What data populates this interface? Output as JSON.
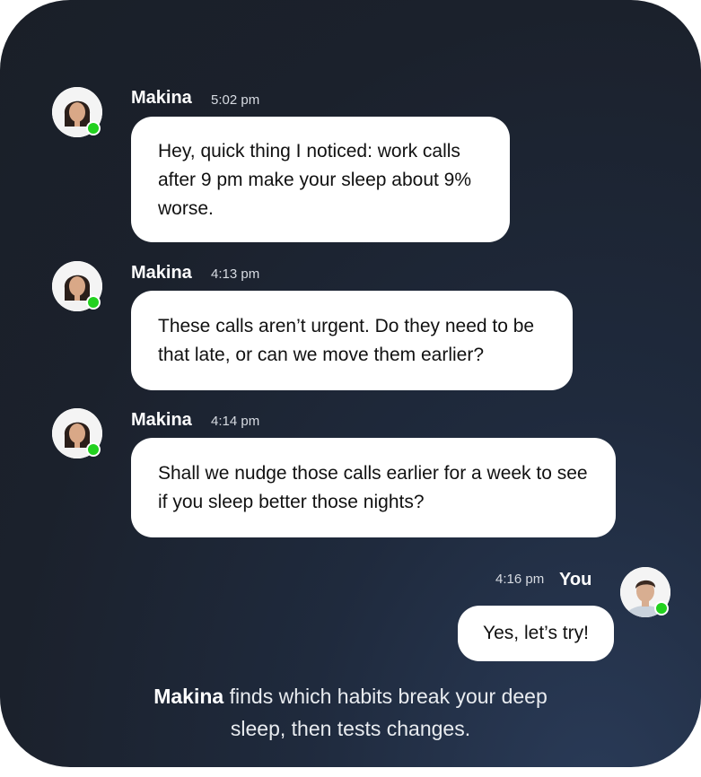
{
  "messages": [
    {
      "sender": "Makina",
      "time": "5:02 pm",
      "text": "Hey, quick thing I noticed: work calls after 9 pm make your sleep about 9% worse.",
      "avatar": "woman-avatar-icon",
      "online": true
    },
    {
      "sender": "Makina",
      "time": "4:13 pm",
      "text": "These calls aren’t urgent. Do they need to be that late, or can we move them earlier?",
      "avatar": "woman-avatar-icon",
      "online": true
    },
    {
      "sender": "Makina",
      "time": "4:14 pm",
      "text": "Shall we nudge those calls earlier for a week to see if you sleep better those nights?",
      "avatar": "woman-avatar-icon",
      "online": true
    },
    {
      "sender": "You",
      "time": "4:16 pm",
      "text": "Yes, let’s try!",
      "avatar": "man-avatar-icon",
      "online": true
    }
  ],
  "caption": {
    "brand": "Makina",
    "text": " finds which habits break your deep sleep, then tests changes."
  },
  "colors": {
    "background": "#1b212c",
    "bubble": "#ffffff",
    "online": "#22d11f"
  }
}
